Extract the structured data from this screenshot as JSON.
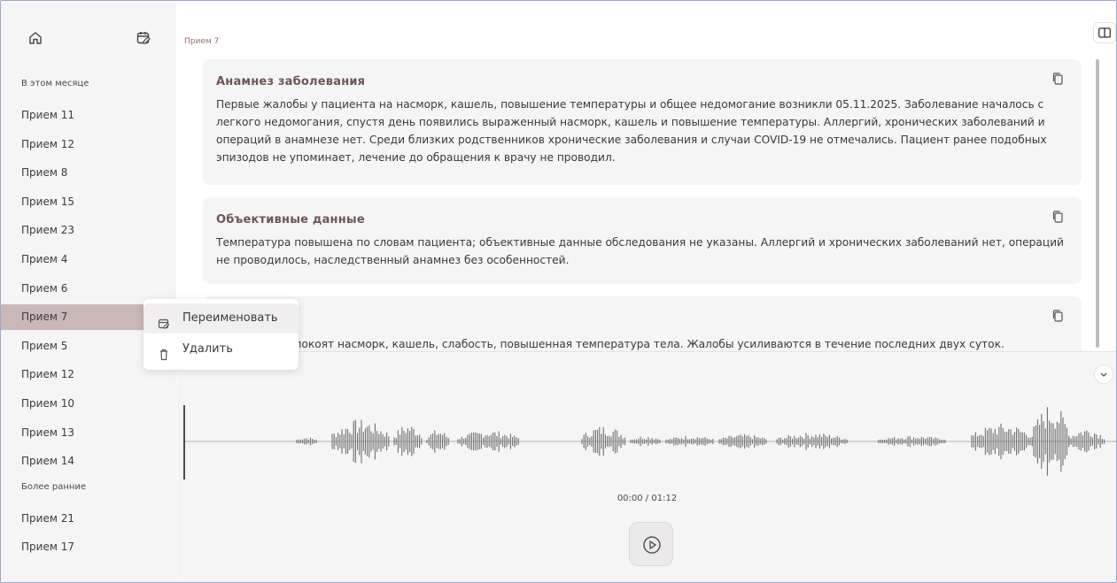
{
  "sidebar": {
    "groups": [
      {
        "title": "В этом месяце",
        "items": [
          "Прием 11",
          "Прием 12",
          "Прием 8",
          "Прием 15",
          "Прием 23",
          "Прием 4",
          "Прием 6",
          "Прием 7",
          "Прием 5",
          "Прием 12",
          "Прием 10",
          "Прием 13",
          "Прием 14"
        ]
      },
      {
        "title": "Более ранние",
        "items": [
          "Прием 21",
          "Прием 17"
        ]
      }
    ],
    "active_item": "Прием 7"
  },
  "breadcrumb": "Прием 7",
  "cards": [
    {
      "title": "Анамнез заболевания",
      "text": "Первые жалобы у пациента на насморк, кашель, повышение температуры и общее недомогание возникли 05.11.2025. Заболевание началось с легкого недомогания, спустя день появились выраженный насморк, кашель и повышение температуры. Аллергий, хронических заболеваний и операций в анамнезе нет. Среди близких родственников хронические заболевания и случаи COVID-19 не отмечались. Пациент ранее подобных эпизодов не упоминает, лечение до обращения к врачу не проводил."
    },
    {
      "title": "Объективные данные",
      "text": "Температура повышена по словам пациента; объективные данные обследования не указаны. Аллергий и хронических заболеваний нет, операций не проводилось, наследственный анамнез без особенностей."
    },
    {
      "title": "",
      "text": "Пациента беспокоят насморк, кашель, слабость, повышенная температура тела. Жалобы усиливаются в течение последних двух суток."
    }
  ],
  "context_menu": {
    "items": [
      {
        "label": "Переименовать",
        "icon": "edit-calendar-icon"
      },
      {
        "label": "Удалить",
        "icon": "trash-icon"
      }
    ]
  },
  "player": {
    "time": "00:00 / 01:12",
    "position_fraction": 0.0
  },
  "colors": {
    "active_item": "#c8b8b8",
    "card_title": "#6e5555",
    "panel_bg": "#f6f5f5"
  }
}
